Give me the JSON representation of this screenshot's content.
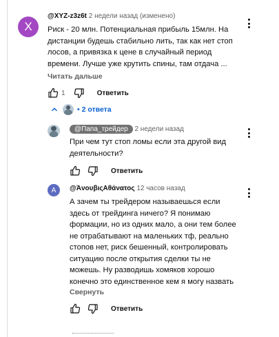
{
  "comment": {
    "avatar_letter": "X",
    "author": "@XYZ-z3z6t",
    "meta": "2 недели назад (изменено)",
    "lines": [
      "Риск - 20 млн. Потенциальная прибыль 15млн. На",
      "дистанции будешь стабильно лить, так как нет стоп",
      "лосов, а привязка к цене в случайный период",
      "времени. Лучше уже крутить спины, там отдача ..."
    ],
    "read_more": "Читать дальше",
    "likes": "1",
    "reply": "Ответить"
  },
  "replies_toggle": "• 2 ответа",
  "reply1": {
    "author": "@Папа_трейдер",
    "meta": "2 недели назад",
    "lines": [
      "При чем тут стоп ломы если эта другой вид",
      "деятельности?"
    ],
    "reply": "Ответить"
  },
  "reply2": {
    "avatar_letter": "A",
    "author": "@ἈνουβιςΑθάνατος",
    "meta": "12 часов назад",
    "lines": [
      "А зачем ты трейдером называешься если",
      "здесь от трейдинга ничего? Я понимаю",
      "формации, но из одних мало, а они тем более",
      "не отрабатывают на маленьких тф, реально",
      "стопов нет, риск бешенный, контролировать",
      "ситуацию после открытия сделки ты не",
      "можешь. Ну разводишь хомяков хорошо",
      "конечно это единственное кем я могу назвать"
    ],
    "collapse": "Свернуть",
    "reply": "Ответить"
  }
}
